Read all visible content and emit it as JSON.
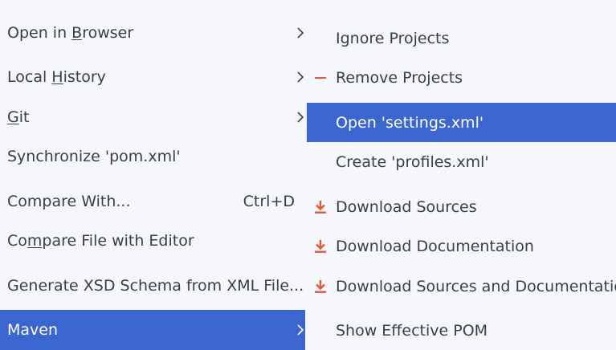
{
  "accent_color": "#3b66cf",
  "icon_color": "#e05a3a",
  "left_menu": {
    "items": [
      {
        "label_pre": "Open in ",
        "mnemonic": "B",
        "label_post": "rowser",
        "submenu": true
      },
      {
        "label_pre": "Local ",
        "mnemonic": "H",
        "label_post": "istory",
        "submenu": true
      },
      {
        "label_pre": "",
        "mnemonic": "G",
        "label_post": "it",
        "submenu": true
      },
      {
        "label": "Synchronize 'pom.xml'"
      },
      {
        "label": "Compare With...",
        "shortcut": "Ctrl+D"
      },
      {
        "label_pre": "Co",
        "mnemonic": "m",
        "label_post": "pare File with Editor"
      },
      {
        "label": "Generate XSD Schema from XML File..."
      },
      {
        "label": "Maven",
        "submenu": true,
        "selected": true
      }
    ]
  },
  "right_menu": {
    "items": [
      {
        "label": "Ignore Projects"
      },
      {
        "label": "Remove Projects",
        "icon": "minus-icon"
      },
      {
        "label": "Open 'settings.xml'",
        "selected": true
      },
      {
        "label": "Create 'profiles.xml'"
      },
      {
        "label": "Download Sources",
        "icon": "download-icon"
      },
      {
        "label": "Download Documentation",
        "icon": "download-icon"
      },
      {
        "label": "Download Sources and Documentation",
        "icon": "download-icon"
      },
      {
        "label": "Show Effective POM"
      }
    ]
  }
}
